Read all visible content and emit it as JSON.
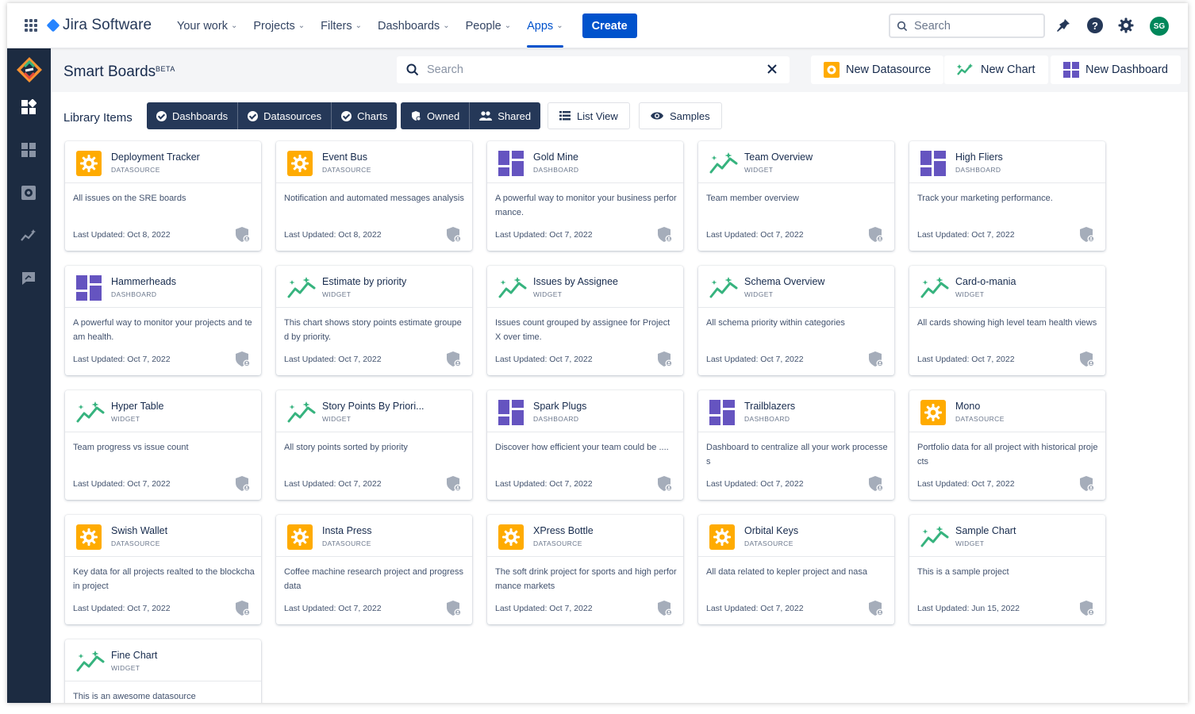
{
  "topnav": {
    "brand": "Jira Software",
    "items": [
      {
        "label": "Your work",
        "icon": "chevron-down-icon"
      },
      {
        "label": "Projects",
        "icon": "chevron-down-icon"
      },
      {
        "label": "Filters",
        "icon": "chevron-down-icon"
      },
      {
        "label": "Dashboards",
        "icon": "chevron-down-icon"
      },
      {
        "label": "People",
        "icon": "chevron-down-icon"
      },
      {
        "label": "Apps",
        "icon": "chevron-down-icon",
        "active": true
      }
    ],
    "create_label": "Create",
    "search_placeholder": "Search",
    "avatar_initials": "SG",
    "colors": {
      "primary": "#0052CC",
      "avatar": "#00875A"
    }
  },
  "app": {
    "title": "Smart Boards",
    "badge": "BETA",
    "search_placeholder": "Search",
    "buttons": {
      "new_datasource": "New Datasource",
      "new_chart": "New Chart",
      "new_dashboard": "New Dashboard"
    },
    "colors": {
      "rail": "#1c2b41",
      "datasource": "#FFAB00",
      "dashboard": "#6554C0",
      "widget": "#36B37E"
    }
  },
  "filters": {
    "label": "Library Items",
    "types": [
      "Dashboards",
      "Datasources",
      "Charts"
    ],
    "ownership": [
      "Owned",
      "Shared"
    ],
    "list_view": "List View",
    "samples": "Samples"
  },
  "cards": [
    {
      "name": "Deployment Tracker",
      "type": "DATASOURCE",
      "desc": "All issues on the SRE boards",
      "updated": "Last Updated: Oct 8, 2022"
    },
    {
      "name": "Event Bus",
      "type": "DATASOURCE",
      "desc": "Notification and automated messages analysis",
      "updated": "Last Updated: Oct 8, 2022"
    },
    {
      "name": "Gold Mine",
      "type": "DASHBOARD",
      "desc": "A powerful way to monitor your business performance.",
      "updated": "Last Updated: Oct 7, 2022"
    },
    {
      "name": "Team Overview",
      "type": "WIDGET",
      "desc": "Team member overview",
      "updated": "Last Updated: Oct 7, 2022"
    },
    {
      "name": "High Fliers",
      "type": "DASHBOARD",
      "desc": "Track your marketing performance.",
      "updated": "Last Updated: Oct 7, 2022"
    },
    {
      "name": "Hammerheads",
      "type": "DASHBOARD",
      "desc": "A powerful way to monitor your projects and team health.",
      "updated": "Last Updated: Oct 7, 2022"
    },
    {
      "name": "Estimate by priority",
      "type": "WIDGET",
      "desc": "This chart shows story points estimate grouped by priority.",
      "updated": "Last Updated: Oct 7, 2022"
    },
    {
      "name": "Issues by Assignee",
      "type": "WIDGET",
      "desc": "Issues count grouped by assignee for Project X over time.",
      "updated": "Last Updated: Oct 7, 2022"
    },
    {
      "name": "Schema Overview",
      "type": "WIDGET",
      "desc": "All schema priority within categories",
      "updated": "Last Updated: Oct 7, 2022"
    },
    {
      "name": "Card-o-mania",
      "type": "WIDGET",
      "desc": "All cards showing high level team health views",
      "updated": "Last Updated: Oct 7, 2022"
    },
    {
      "name": "Hyper Table",
      "type": "WIDGET",
      "desc": "Team progress vs issue count",
      "updated": "Last Updated: Oct 7, 2022"
    },
    {
      "name": "Story Points By Priori...",
      "type": "WIDGET",
      "desc": "All story points sorted by priority",
      "updated": "Last Updated: Oct 7, 2022"
    },
    {
      "name": "Spark Plugs",
      "type": "DASHBOARD",
      "desc": "Discover how efficient your team could be ....",
      "updated": "Last Updated: Oct 7, 2022"
    },
    {
      "name": "Trailblazers",
      "type": "DASHBOARD",
      "desc": "Dashboard to centralize all your work processes",
      "updated": "Last Updated: Oct 7, 2022"
    },
    {
      "name": "Mono",
      "type": "DATASOURCE",
      "desc": "Portfolio data for all project with historical projects",
      "updated": "Last Updated: Oct 7, 2022"
    },
    {
      "name": "Swish Wallet",
      "type": "DATASOURCE",
      "desc": "Key data for all projects realted to the blockchain project",
      "updated": "Last Updated: Oct 7, 2022"
    },
    {
      "name": "Insta Press",
      "type": "DATASOURCE",
      "desc": "Coffee machine research project and progress data",
      "updated": "Last Updated: Oct 7, 2022"
    },
    {
      "name": "XPress Bottle",
      "type": "DATASOURCE",
      "desc": "The soft drink project for sports and high performance markets",
      "updated": "Last Updated: Oct 7, 2022"
    },
    {
      "name": "Orbital Keys",
      "type": "DATASOURCE",
      "desc": "All data related to kepler project and nasa",
      "updated": "Last Updated: Oct 7, 2022"
    },
    {
      "name": "Sample Chart",
      "type": "WIDGET",
      "desc": "This is a sample project",
      "updated": "Last Updated: Jun 15, 2022"
    },
    {
      "name": "Fine Chart",
      "type": "WIDGET",
      "desc": "This is an awesome datasource",
      "updated": ""
    }
  ]
}
